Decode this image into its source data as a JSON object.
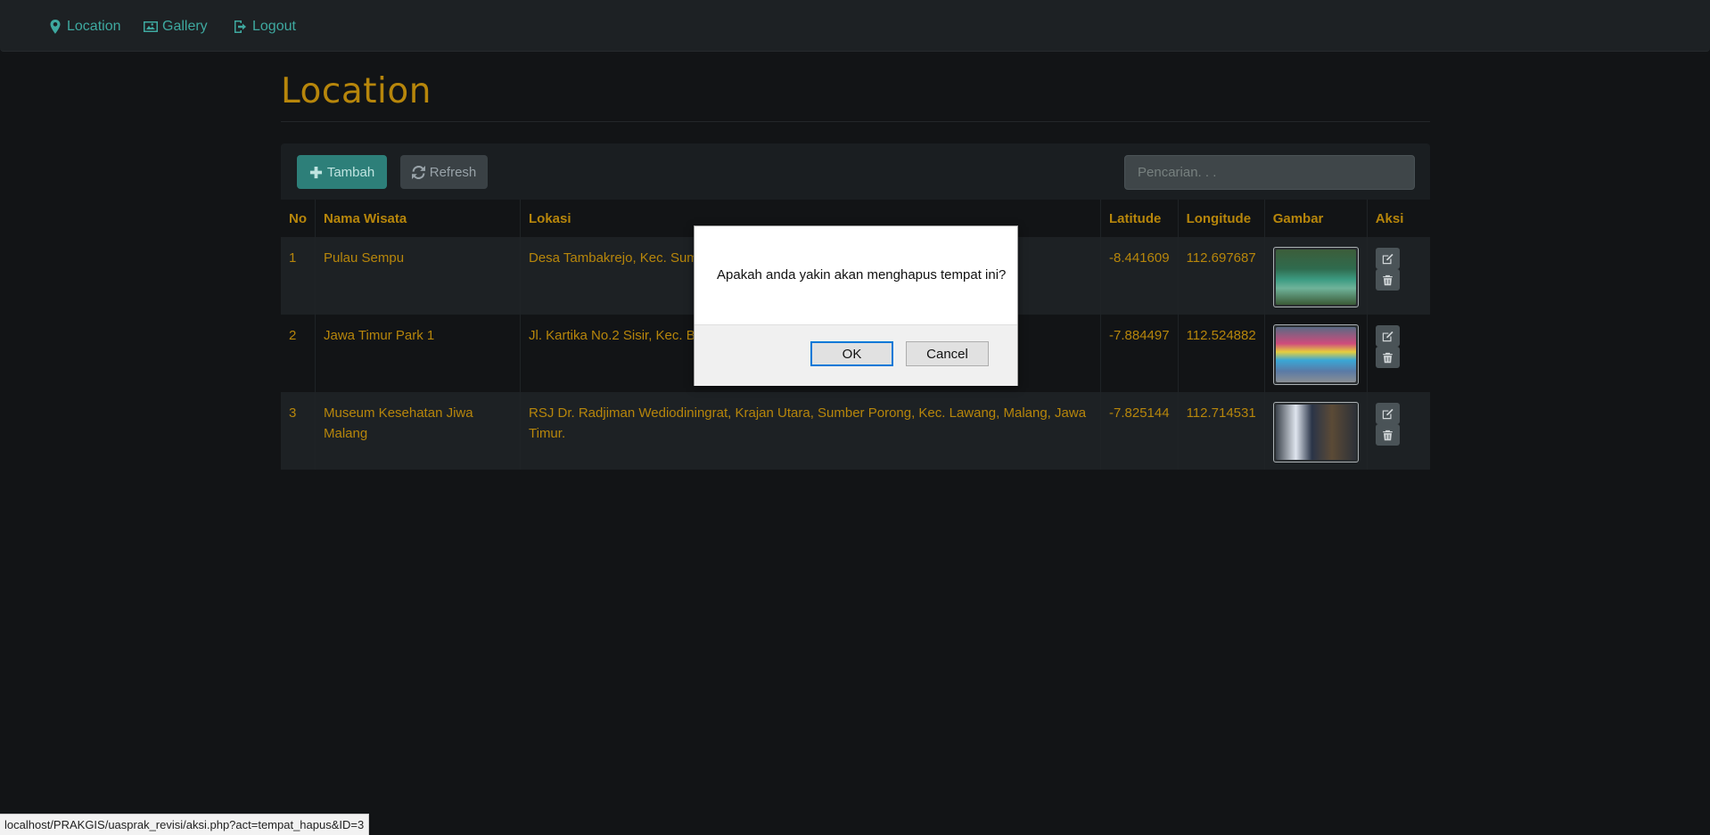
{
  "nav": {
    "items": [
      {
        "label": "Location",
        "icon": "map-marker-icon"
      },
      {
        "label": "Gallery",
        "icon": "picture-icon"
      },
      {
        "label": "Logout",
        "icon": "logout-icon"
      }
    ]
  },
  "page": {
    "title": "Location"
  },
  "toolbar": {
    "add_label": "Tambah",
    "refresh_label": "Refresh",
    "search_placeholder": "Pencarian. . ."
  },
  "table": {
    "headers": [
      "No",
      "Nama Wisata",
      "Lokasi",
      "Latitude",
      "Longitude",
      "Gambar",
      "Aksi"
    ],
    "rows": [
      {
        "no": "1",
        "name": "Pulau Sempu",
        "location": "Desa Tambakrejo, Kec. Sumb",
        "lat": "-8.441609",
        "lng": "112.697687"
      },
      {
        "no": "2",
        "name": "Jawa Timur Park 1",
        "location": "Jl. Kartika No.2 Sisir, Kec. Ba",
        "lat": "-7.884497",
        "lng": "112.524882"
      },
      {
        "no": "3",
        "name": "Museum Kesehatan Jiwa Malang",
        "location": "RSJ Dr. Radjiman Wediodiningrat, Krajan Utara, Sumber Porong, Kec. Lawang, Malang, Jawa Timur.",
        "lat": "-7.825144",
        "lng": "112.714531"
      }
    ]
  },
  "dialog": {
    "message": "Apakah anda yakin akan menghapus tempat ini?",
    "ok_label": "OK",
    "cancel_label": "Cancel"
  },
  "status_url": "localhost/PRAKGIS/uasprak_revisi/aksi.php?act=tempat_hapus&ID=3",
  "colors": {
    "accent": "#b7860b",
    "teal": "#3ea9a0",
    "background": "#121416"
  }
}
